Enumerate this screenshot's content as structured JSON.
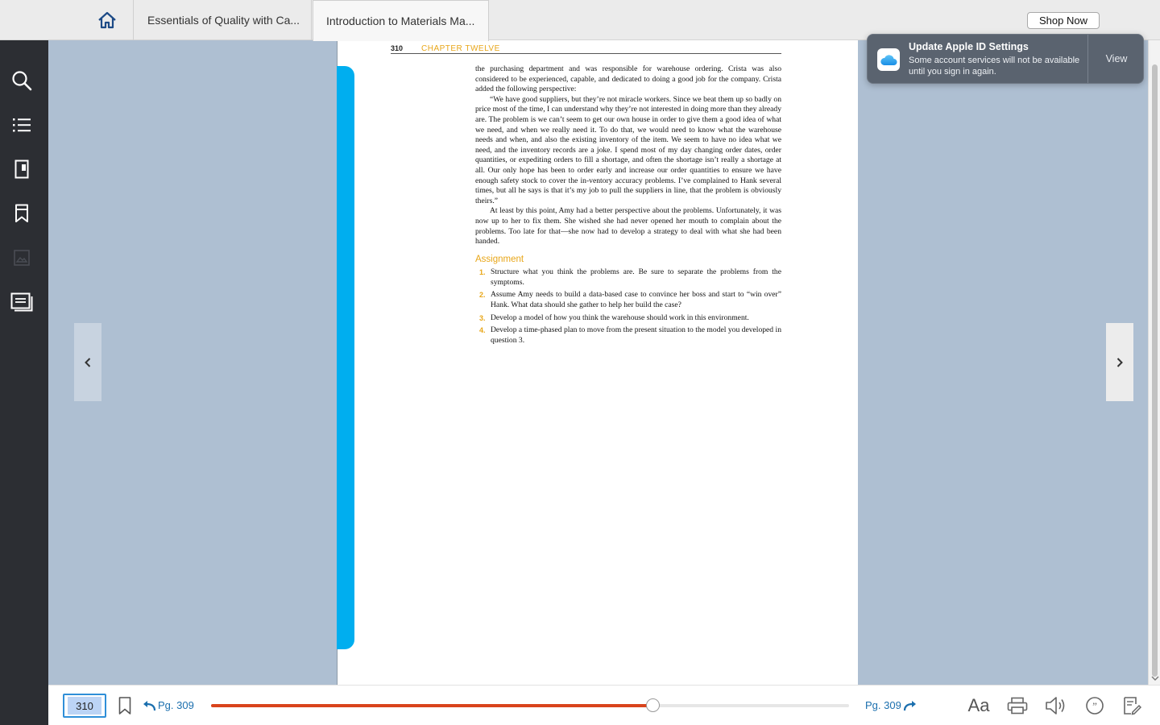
{
  "tabs": [
    {
      "label": "Essentials of Quality with Ca..."
    },
    {
      "label": "Introduction to Materials Ma..."
    }
  ],
  "shop_label": "Shop Now",
  "sidebar": {
    "items": [
      "search-icon",
      "table-of-contents-icon",
      "page-view-icon",
      "bookmarks-icon",
      "image-icon",
      "notes-icon"
    ]
  },
  "page": {
    "number": "310",
    "chapter": "CHAPTER TWELVE",
    "paragraphs": [
      "the purchasing department and was responsible for warehouse ordering. Crista was also considered to be experienced, capable, and dedicated to doing a good job for the company. Crista added the following perspective:",
      "“We have good suppliers, but they’re not miracle workers. Since we beat them up so badly on price most of the time, I can understand why they’re not interested in doing more than they already are. The problem is we can’t seem to get our own house in order to give them a good idea of what we need, and when we really need it. To do that, we would need to know what the warehouse needs and when, and also the existing inventory of the item. We seem to have no idea what we need, and the inventory records are a joke. I spend most of my day changing order dates, order quantities, or expediting orders to fill a shortage, and often the shortage isn’t really a shortage at all. Our only hope has been to order early and increase our order quantities to ensure we have enough safety stock to cover the in-ventory accuracy problems. I’ve complained to Hank several times, but all he says is that it’s my job to pull the suppliers in line, that the problem is obviously theirs.”",
      "At least by this point, Amy had a better perspective about the problems. Unfortunately, it was now up to her to fix them. She wished she had never opened her mouth to complain about the problems. Too late for that—she now had to develop a strategy to deal with what she had been handed."
    ],
    "assignment_heading": "Assignment",
    "assignments": [
      {
        "num": "1.",
        "text": "Structure what you think the problems are. Be sure to separate the problems from the symptoms."
      },
      {
        "num": "2.",
        "text": "Assume Amy needs to build a data-based case to convince her boss and start to “win over” Hank. What data should she gather to help her build the case?"
      },
      {
        "num": "3.",
        "text": "Develop a model of how you think the warehouse should work in this environment."
      },
      {
        "num": "4.",
        "text": "Develop a time-phased plan to move from the present situation to the model you developed in question 3."
      }
    ]
  },
  "notification": {
    "title": "Update Apple ID Settings",
    "message": "Some account services will not be available until you sign in again.",
    "action": "View"
  },
  "bottombar": {
    "page_value": "310",
    "back_label": "Pg. 309",
    "forward_label": "Pg. 309",
    "progress_fraction": 0.692,
    "font_label": "Aa"
  },
  "colors": {
    "accent_blue": "#00aeef",
    "chapter_gold": "#e8a618",
    "progress_red": "#d9431c",
    "link_blue": "#1b6fae"
  }
}
